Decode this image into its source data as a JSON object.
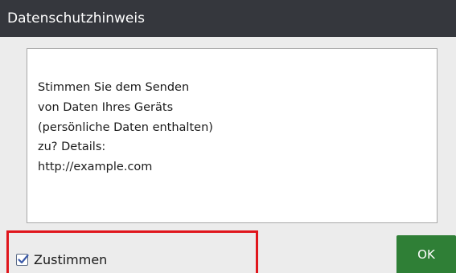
{
  "dialog": {
    "title": "Datenschutzhinweis",
    "message_lines": [
      "Stimmen Sie dem Senden",
      "von Daten Ihres Geräts",
      "(persönliche Daten enthalten)",
      "zu? Details:",
      "http://example.com"
    ],
    "agree_checkbox": {
      "label": "Zustimmen",
      "checked": true,
      "icon": "checkmark-icon"
    },
    "ok_button": {
      "label": "OK"
    }
  },
  "colors": {
    "titlebar": "#35373d",
    "background": "#ececec",
    "highlight_border": "#e0161c",
    "ok_button": "#2f7f36",
    "checkbox_accent": "#3b5aa8"
  }
}
